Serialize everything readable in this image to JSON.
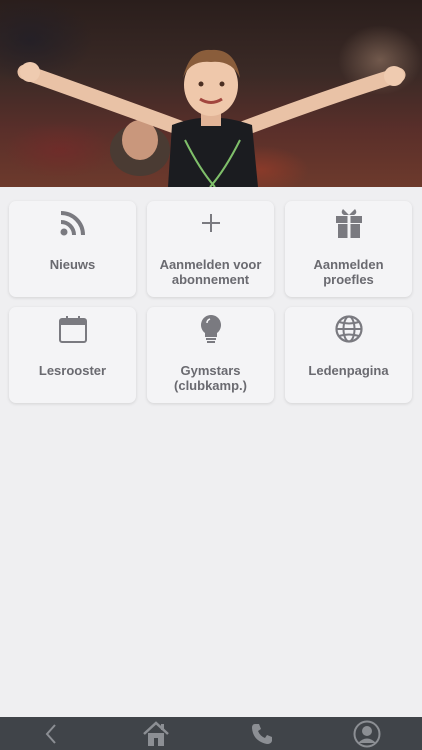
{
  "menu": {
    "tiles": [
      {
        "label": "Nieuws",
        "icon": "rss-icon"
      },
      {
        "label": "Aanmelden voor abonnement",
        "icon": "plus-icon"
      },
      {
        "label": "Aanmelden proefles",
        "icon": "gift-icon"
      },
      {
        "label": "Lesrooster",
        "icon": "calendar-icon"
      },
      {
        "label": "Gymstars (clubkamp.)",
        "icon": "lightbulb-icon"
      },
      {
        "label": "Ledenpagina",
        "icon": "globe-icon"
      }
    ]
  },
  "tabbar": {
    "items": [
      {
        "icon": "back-icon"
      },
      {
        "icon": "home-icon"
      },
      {
        "icon": "phone-icon"
      },
      {
        "icon": "account-icon"
      }
    ]
  },
  "colors": {
    "tile_bg": "#f4f4f6",
    "icon": "#7a7a80",
    "tabbar_bg": "#404449",
    "tabbar_icon": "#8c8f94"
  }
}
